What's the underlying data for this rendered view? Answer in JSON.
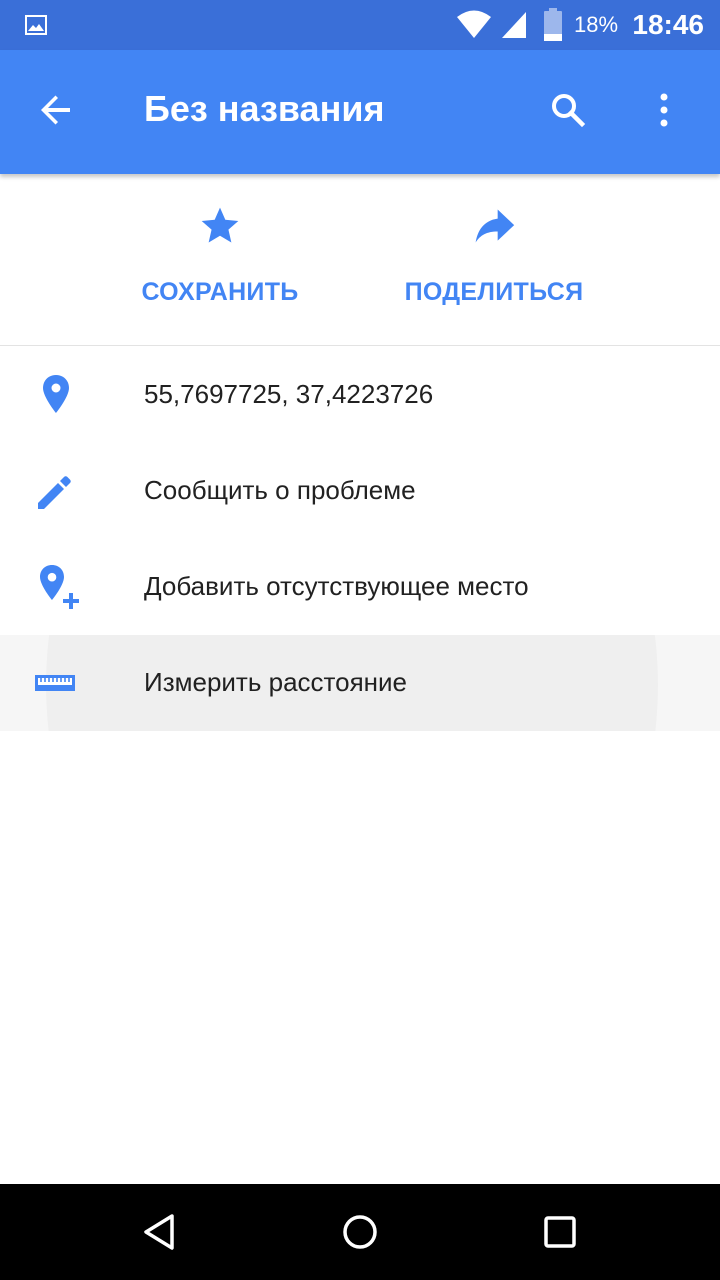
{
  "status_bar": {
    "battery_text": "18%",
    "time": "18:46",
    "icons": [
      "gallery-icon",
      "wifi-icon",
      "signal-icon",
      "battery-icon"
    ]
  },
  "toolbar": {
    "title": "Без названия",
    "icons": [
      "back-arrow-icon",
      "search-icon",
      "more-vert-icon"
    ]
  },
  "actions": [
    {
      "label": "СОХРАНИТЬ",
      "icon": "star-icon"
    },
    {
      "label": "ПОДЕЛИТЬСЯ",
      "icon": "share-icon"
    }
  ],
  "list": [
    {
      "text": "55,7697725, 37,4223726",
      "icon": "location-pin-icon"
    },
    {
      "text": "Сообщить о проблеме",
      "icon": "pencil-icon"
    },
    {
      "text": "Добавить отсутствующее место",
      "icon": "add-location-icon"
    },
    {
      "text": "Измерить расстояние",
      "icon": "ruler-icon"
    }
  ],
  "nav_bar": {
    "icons": [
      "nav-back-icon",
      "nav-home-icon",
      "nav-recents-icon"
    ]
  },
  "colors": {
    "status_bar": "#3a6fd8",
    "toolbar": "#4285f4",
    "accent": "#4285f4",
    "text": "#212121"
  }
}
